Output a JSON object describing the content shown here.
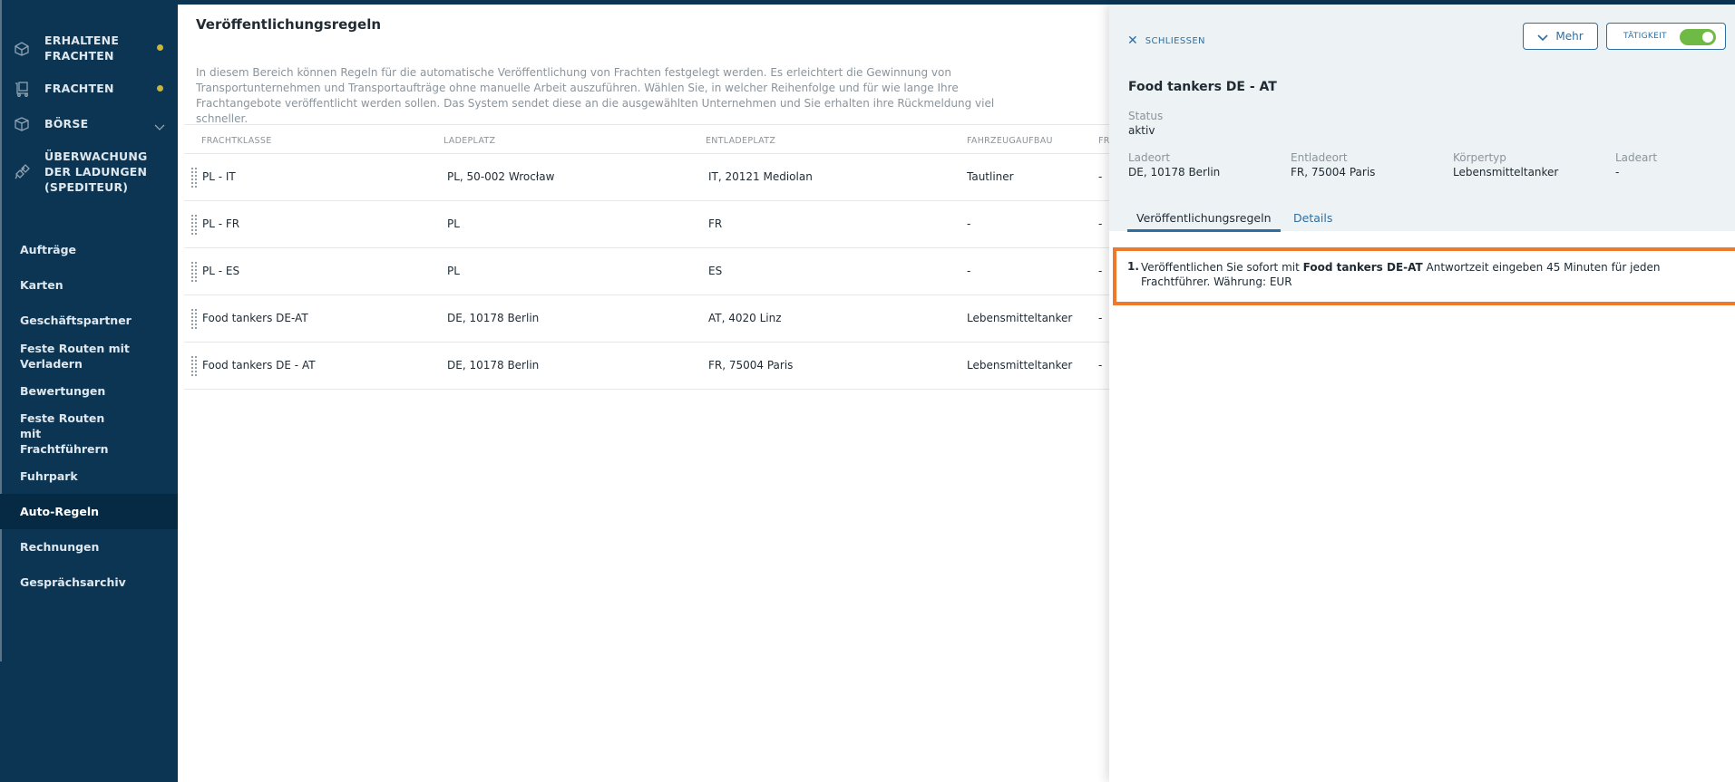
{
  "sidebar": {
    "top_items": [
      {
        "label": "ERHALTENE FRACHTEN",
        "icon": "received-freight-icon",
        "dot": true
      },
      {
        "label": "FRACHTEN",
        "icon": "freight-icon",
        "dot": true
      },
      {
        "label": "BÖRSE",
        "icon": "exchange-box-icon",
        "chevron": true
      },
      {
        "label": "ÜBERWACHUNG DER LADUNGEN (SPEDITEUR)",
        "icon": "satellite-icon"
      }
    ],
    "sub_items": [
      {
        "label": "Aufträge"
      },
      {
        "label": "Karten"
      },
      {
        "label": "Geschäftspartner"
      },
      {
        "label": "Feste Routen mit Verladern"
      },
      {
        "label": "Bewertungen"
      },
      {
        "label": "Feste Routen mit Frachtführern"
      },
      {
        "label": "Fuhrpark"
      },
      {
        "label": "Auto-Regeln",
        "active": true
      },
      {
        "label": "Rechnungen"
      },
      {
        "label": "Gesprächsarchiv"
      }
    ],
    "dot_color": "#c9b53a"
  },
  "main": {
    "title": "Veröffentlichungsregeln",
    "intro": "In diesem Bereich können Regeln für die automatische Veröffentlichung von Frachten festgelegt werden. Es erleichtert die Gewinnung von Transportunternehmen und Transportaufträge ohne manuelle Arbeit auszuführen. Wählen Sie, in welcher Reihenfolge und für wie lange Ihre Frachtangebote veröffentlicht werden sollen. Das System sendet diese an die ausgewählten Unternehmen und Sie erhalten ihre Rückmeldung viel schneller.",
    "table": {
      "columns": [
        "FRACHTKLASSE",
        "LADEPLATZ",
        "ENTLADEPLATZ",
        "FAHRZEUGAUFBAU",
        "FR"
      ],
      "rows": [
        {
          "klasse": "PL - IT",
          "lade": "PL, 50-002 Wrocław",
          "entlade": "IT, 20121 Mediolan",
          "aufbau": "Tautliner",
          "extra": "-"
        },
        {
          "klasse": "PL - FR",
          "lade": "PL",
          "entlade": "FR",
          "aufbau": "-",
          "extra": "-"
        },
        {
          "klasse": "PL - ES",
          "lade": "PL",
          "entlade": "ES",
          "aufbau": "-",
          "extra": "-"
        },
        {
          "klasse": "Food tankers DE-AT",
          "lade": "DE, 10178 Berlin",
          "entlade": "AT, 4020 Linz",
          "aufbau": "Lebensmitteltanker",
          "extra": "-"
        },
        {
          "klasse": "Food tankers DE - AT",
          "lade": "DE, 10178 Berlin",
          "entlade": "FR, 75004 Paris",
          "aufbau": "Lebensmitteltanker",
          "extra": "-"
        }
      ]
    }
  },
  "panel": {
    "close_label": "SCHLIESSEN",
    "more_label": "Mehr",
    "activity_label": "TÄTIGKEIT",
    "activity_on": true,
    "title": "Food tankers DE - AT",
    "status_label": "Status",
    "status_value": "aktiv",
    "fields": [
      {
        "label": "Ladeort",
        "value": "DE, 10178 Berlin"
      },
      {
        "label": "Entladeort",
        "value": "FR, 75004 Paris"
      },
      {
        "label": "Körpertyp",
        "value": "Lebensmitteltanker"
      },
      {
        "label": "Ladeart",
        "value": "-"
      }
    ],
    "tabs": [
      {
        "label": "Veröffentlichungsregeln",
        "active": true
      },
      {
        "label": "Details",
        "active": false
      }
    ],
    "rule": {
      "number": "1.",
      "prefix": "Veröffentlichen Sie sofort mit ",
      "company": "Food tankers DE-AT",
      "suffix": " Antwortzeit eingeben 45 Minuten für jeden Frachtführer. Währung: EUR"
    },
    "accent_color": "#2d6fa3",
    "highlight_color": "#f0782a",
    "toggle_color": "#6fba44"
  }
}
